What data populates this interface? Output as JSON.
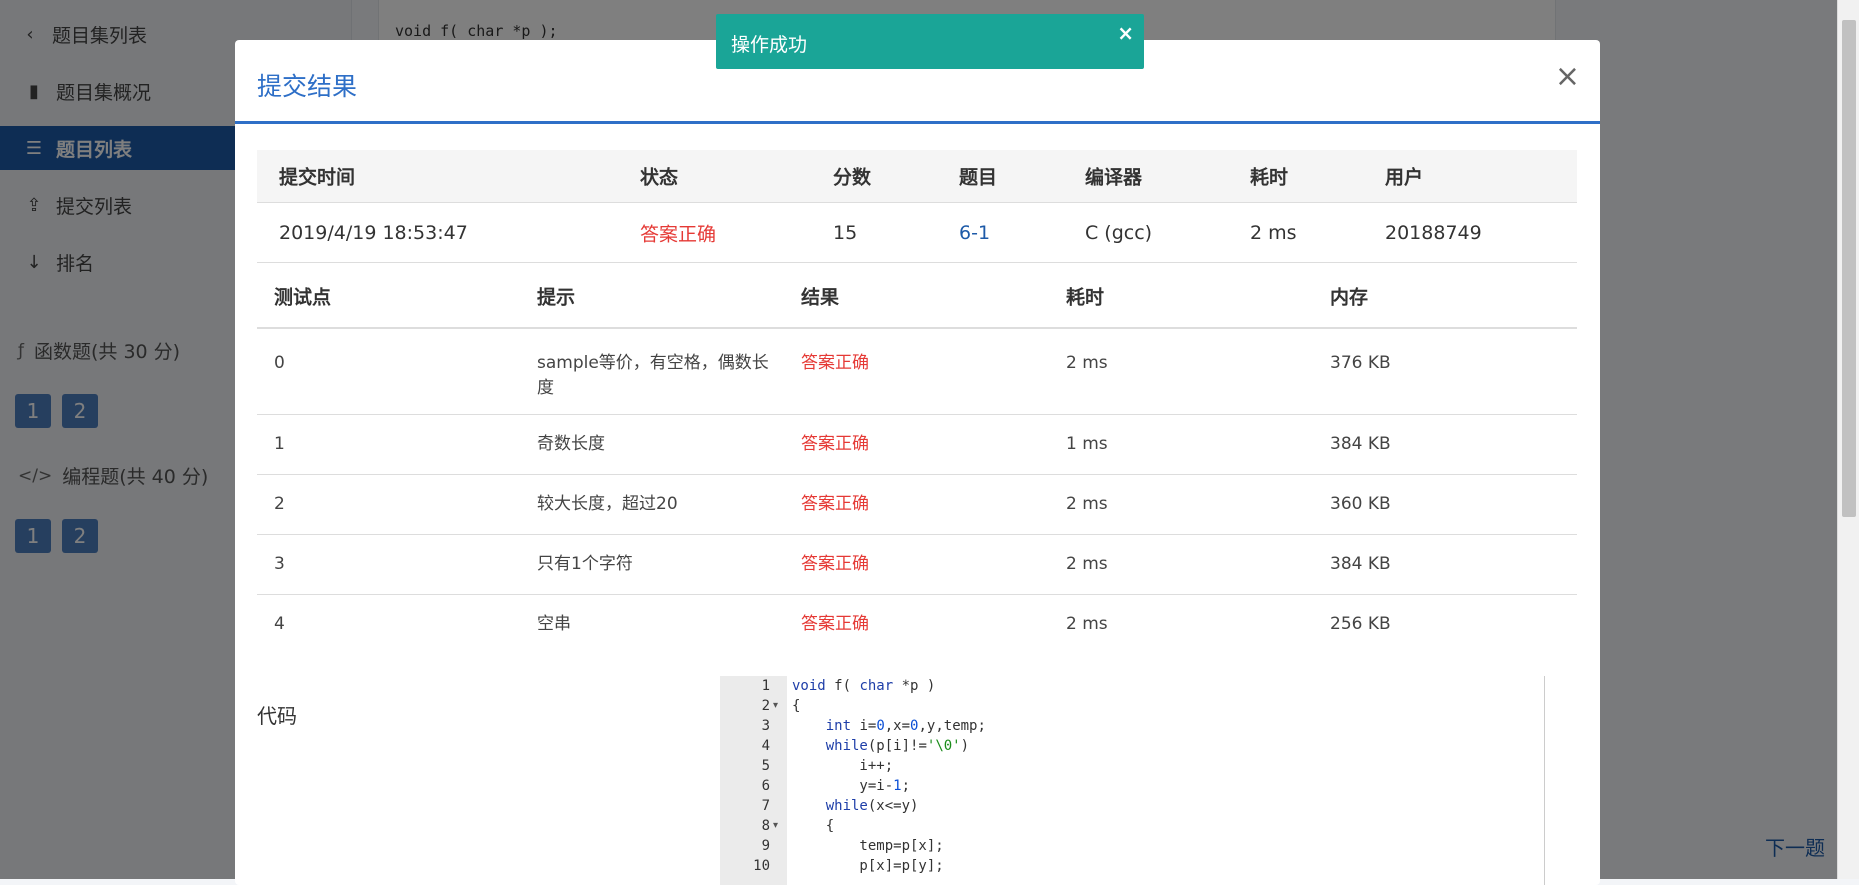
{
  "sidebar": {
    "back_label": "题目集列表",
    "items": [
      {
        "label": "题目集概况",
        "icon": "book-icon"
      },
      {
        "label": "题目列表",
        "icon": "list-icon"
      },
      {
        "label": "提交列表",
        "icon": "upload-icon"
      },
      {
        "label": "排名",
        "icon": "sort-numeric-icon"
      }
    ],
    "sections": [
      {
        "title": "函数题(共 30 分)",
        "icon": "function-icon",
        "buttons": [
          "1",
          "2"
        ]
      },
      {
        "title": "编程题(共 40 分)",
        "icon": "code-icon",
        "buttons": [
          "1",
          "2"
        ]
      }
    ]
  },
  "background": {
    "code_snippet": "void f( char *p );",
    "next_label": "下一题"
  },
  "toast": {
    "message": "操作成功",
    "close": "×"
  },
  "modal": {
    "title": "提交结果",
    "close": "×",
    "summary": {
      "headers": {
        "time": "提交时间",
        "status": "状态",
        "score": "分数",
        "problem": "题目",
        "compiler": "编译器",
        "elapsed": "耗时",
        "user": "用户"
      },
      "row": {
        "time": "2019/4/19 18:53:47",
        "status": "答案正确",
        "score": "15",
        "problem": "6-1",
        "compiler": "C (gcc)",
        "elapsed": "2 ms",
        "user": "20188749"
      }
    },
    "tests": {
      "headers": {
        "point": "测试点",
        "hint": "提示",
        "result": "结果",
        "elapsed": "耗时",
        "memory": "内存"
      },
      "rows": [
        {
          "point": "0",
          "hint": "sample等价，有空格，偶数长度",
          "result": "答案正确",
          "elapsed": "2 ms",
          "memory": "376 KB"
        },
        {
          "point": "1",
          "hint": "奇数长度",
          "result": "答案正确",
          "elapsed": "1 ms",
          "memory": "384 KB"
        },
        {
          "point": "2",
          "hint": "较大长度，超过20",
          "result": "答案正确",
          "elapsed": "2 ms",
          "memory": "360 KB"
        },
        {
          "point": "3",
          "hint": "只有1个字符",
          "result": "答案正确",
          "elapsed": "2 ms",
          "memory": "384 KB"
        },
        {
          "point": "4",
          "hint": "空串",
          "result": "答案正确",
          "elapsed": "2 ms",
          "memory": "256 KB"
        }
      ]
    },
    "code_label": "代码",
    "code_lines": [
      "void f( char *p )",
      "{",
      "    int i=0,x=0,y,temp;",
      "    while(p[i]!='\\0')",
      "        i++;",
      "        y=i-1;",
      "    while(x<=y)",
      "    {",
      "        temp=p[x];",
      "        p[x]=p[y];"
    ],
    "line_numbers": [
      "1",
      "2",
      "3",
      "4",
      "5",
      "6",
      "7",
      "8",
      "9",
      "10"
    ]
  },
  "colors": {
    "accent": "#2e6fc7",
    "success": "#e53935",
    "toast": "#1aa597",
    "sidebar_active": "#1d5aa8"
  }
}
